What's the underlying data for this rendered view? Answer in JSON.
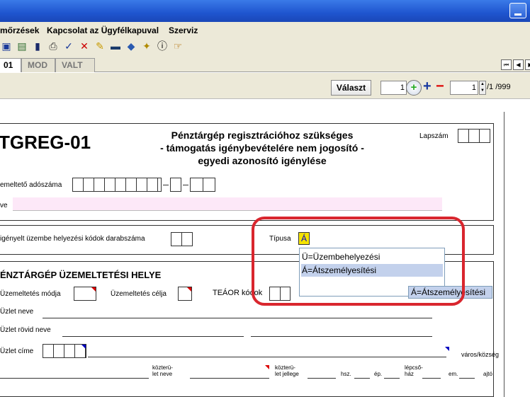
{
  "menu": {
    "items": [
      "mőrzések",
      "Kapcsolat az Ügyfélkapuval",
      "Szerviz"
    ]
  },
  "toolbar": {
    "icons": [
      "save-icon",
      "open-icon",
      "book-icon",
      "print-icon",
      "check-icon",
      "cross-icon",
      "edit-icon",
      "card-icon",
      "db-icon",
      "key-icon",
      "info-icon",
      "hand-icon"
    ]
  },
  "tabs": {
    "t1": "01",
    "t2": "MOD",
    "t3": "VALT"
  },
  "controls": {
    "valaszt": "Választ",
    "page_value": "1",
    "page_num": "1",
    "page_total": "/1 /999"
  },
  "form": {
    "code": "TGREG-01",
    "title1": "Pénztárgép regisztrációhoz szükséges",
    "title2": "- támogatás igénybevételére nem jogosító -",
    "title3": "egyedi azonosító igénylése",
    "lapszam": "Lapszám",
    "adoszam_lbl": "emeltető adószáma",
    "neve_lbl": "ve",
    "darab_lbl": "igényelt üzembe helyezési kódok darabszáma",
    "tipusa_lbl": "Típusa",
    "tipusa_val": "Á",
    "section_title": "ÉNZTÁRGÉP ÜZEMELTETÉSI HELYE",
    "modja": "Üzemeltetés módja",
    "celja": "Üzemeltetés célja",
    "teaor": "TEÁOR kódok",
    "uzlet_neve": "Üzlet neve",
    "uzlet_rovid": "Üzlet rövid neve",
    "uzlet_cime": "Üzlet címe",
    "varos": "város/község",
    "kozterulet_neve_1": "közterü-",
    "kozterulet_neve_2": "let neve",
    "kozterulet_jellege_1": "közterü-",
    "kozterulet_jellege_2": "let jellege",
    "hsz": "hsz.",
    "ep": "ép.",
    "lepcso1": "lépcső-",
    "lepcso2": "ház",
    "em": "em.",
    "ajto": "ajtó"
  },
  "dropdown": {
    "options": [
      "Ü=Üzembehelyezési",
      "Á=Átszemélyesítési"
    ],
    "selected_index": 1,
    "tooltip": "Á=Átszemélyesítési"
  }
}
